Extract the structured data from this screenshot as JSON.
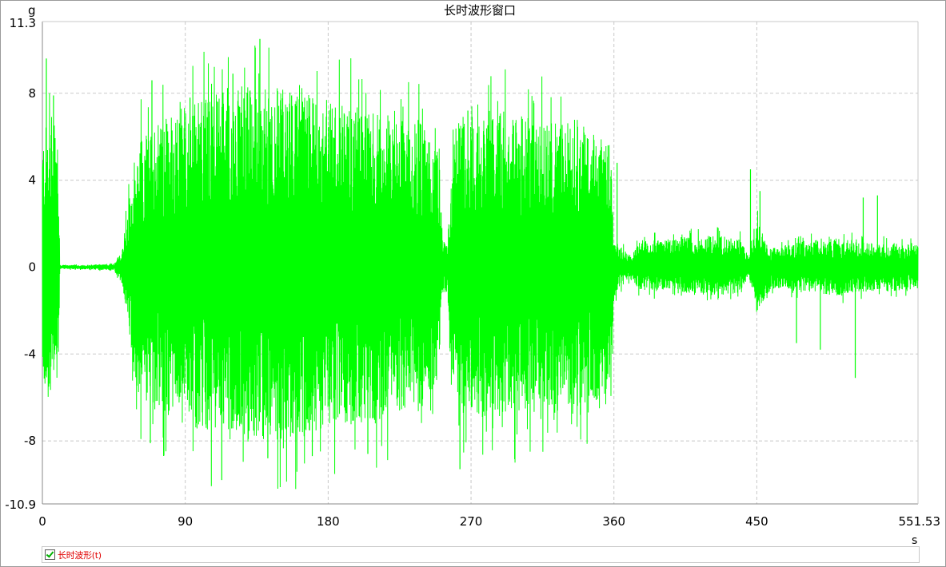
{
  "chart_data": {
    "type": "line",
    "title": "长时波形窗口",
    "xlabel": "s",
    "ylabel": "g",
    "xlim": [
      0,
      551.53
    ],
    "ylim": [
      -10.9,
      11.3
    ],
    "x_ticks": [
      "0",
      "90",
      "180",
      "270",
      "360",
      "450",
      "551.53"
    ],
    "x_tick_values": [
      0,
      90,
      180,
      270,
      360,
      450,
      551.53
    ],
    "y_ticks": [
      "11.3",
      "8",
      "4",
      "0",
      "-4",
      "-8",
      "-10.9"
    ],
    "y_tick_values": [
      11.3,
      8,
      4,
      0,
      -4,
      -8,
      -10.9
    ],
    "grid": true,
    "series": [
      {
        "name": "长时波形(t)",
        "color": "#00ff00",
        "envelope": {
          "t": [
            0,
            5,
            10,
            11,
            12,
            30,
            45,
            50,
            55,
            60,
            90,
            120,
            150,
            180,
            210,
            240,
            250,
            252,
            255,
            258,
            262,
            265,
            270,
            300,
            330,
            355,
            358,
            360,
            362,
            365,
            370,
            375,
            380,
            400,
            420,
            440,
            445,
            450,
            455,
            460,
            480,
            500,
            520,
            540,
            551.53
          ],
          "upper": [
            5.5,
            6.5,
            5.2,
            0.1,
            0.08,
            0.1,
            0.15,
            0.7,
            3.0,
            5.5,
            6.8,
            7.6,
            7.6,
            7.0,
            6.5,
            6.0,
            4.5,
            1.2,
            1.0,
            4.2,
            5.8,
            6.5,
            6.4,
            6.3,
            6.0,
            5.8,
            4.8,
            1.3,
            1.0,
            0.8,
            0.5,
            0.9,
            1.1,
            1.2,
            1.4,
            1.2,
            0.4,
            1.9,
            1.2,
            0.8,
            1.1,
            1.2,
            1.0,
            1.0,
            0.9
          ],
          "lower": [
            -5.0,
            -5.5,
            -5.2,
            -0.1,
            -0.08,
            -0.1,
            -0.15,
            -0.7,
            -3.0,
            -5.5,
            -6.6,
            -7.3,
            -7.3,
            -6.8,
            -6.4,
            -6.0,
            -4.5,
            -1.2,
            -1.0,
            -4.2,
            -5.9,
            -6.4,
            -6.3,
            -6.2,
            -5.9,
            -5.8,
            -4.8,
            -1.3,
            -1.0,
            -0.8,
            -0.5,
            -0.9,
            -1.0,
            -1.1,
            -1.2,
            -1.1,
            -0.4,
            -1.9,
            -1.3,
            -0.9,
            -1.0,
            -1.2,
            -1.0,
            -1.0,
            -0.9
          ]
        },
        "peaks": [
          {
            "t": 2.5,
            "v": 9.6
          },
          {
            "t": 7.0,
            "v": 7.9
          },
          {
            "t": 4.0,
            "v": -5.5
          },
          {
            "t": 68,
            "v": -8.1
          },
          {
            "t": 69,
            "v": 8.6
          },
          {
            "t": 93,
            "v": 7.8
          },
          {
            "t": 113,
            "v": -9.8
          },
          {
            "t": 120,
            "v": 8.9
          },
          {
            "t": 137,
            "v": 10.5
          },
          {
            "t": 142,
            "v": -8.8
          },
          {
            "t": 157,
            "v": 7.9
          },
          {
            "t": 170,
            "v": -8.7
          },
          {
            "t": 205,
            "v": -8.6
          },
          {
            "t": 263,
            "v": -9.3
          },
          {
            "t": 268,
            "v": 7.2
          },
          {
            "t": 287,
            "v": 6.3
          },
          {
            "t": 362,
            "v": 4.8
          },
          {
            "t": 446,
            "v": 4.5
          },
          {
            "t": 452,
            "v": 3.5
          },
          {
            "t": 475,
            "v": -3.5
          },
          {
            "t": 490,
            "v": -3.8
          },
          {
            "t": 512,
            "v": -5.1
          },
          {
            "t": 517,
            "v": 3.2
          },
          {
            "t": 526,
            "v": 3.3
          }
        ]
      }
    ]
  },
  "legend": {
    "label": "长时波形(t)"
  }
}
